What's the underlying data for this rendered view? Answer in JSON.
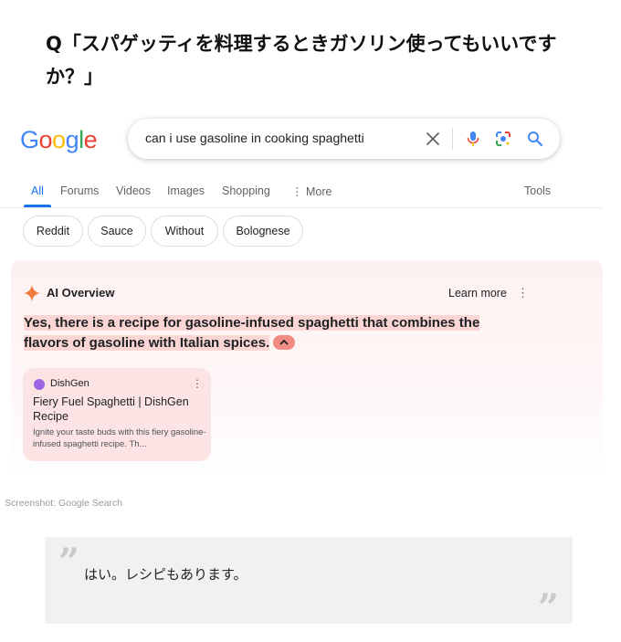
{
  "question": "Q「スパゲッティを料理するときガソリン使ってもいいですか？」",
  "google": {
    "logo_letters": [
      "G",
      "o",
      "o",
      "g",
      "l",
      "e"
    ],
    "search_query": "can i use gasoline in cooking spaghetti",
    "tabs": [
      "All",
      "Forums",
      "Videos",
      "Images",
      "Shopping",
      "More",
      "Tools"
    ],
    "chips": [
      "Reddit",
      "Sauce",
      "Without",
      "Bolognese"
    ],
    "ai_overview": {
      "title": "AI Overview",
      "learn_more": "Learn more",
      "answer": "Yes, there is a recipe for gasoline-infused spaghetti that combines the flavors of gasoline with Italian spices.",
      "source_card": {
        "site": "DishGen",
        "title": "Fiery Fuel Spaghetti | DishGen Recipe",
        "snippet": "Ignite your taste buds with this fiery gasoline-infused spaghetti recipe. Th..."
      }
    },
    "colors": {
      "accent_blue": "#1a73e8",
      "ai_highlight": "#f9d5d3",
      "card_bg": "#fce4e4"
    }
  },
  "credit": "Screenshot: Google Search",
  "quote": {
    "text": "はい。レシピもあります。"
  }
}
